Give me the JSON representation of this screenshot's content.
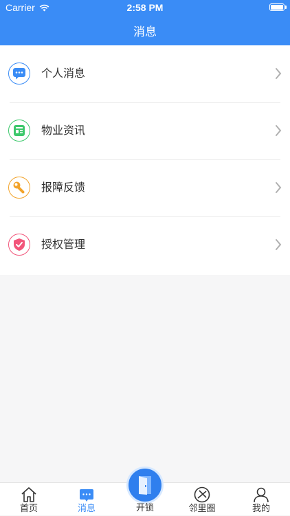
{
  "status_bar": {
    "carrier": "Carrier",
    "time": "2:58 PM",
    "wifi_icon": "wifi-icon",
    "battery_icon": "battery-icon"
  },
  "header": {
    "title": "消息"
  },
  "menu": {
    "items": [
      {
        "label": "个人消息",
        "icon": "chat-bubble-icon",
        "color": "#3a8cf6"
      },
      {
        "label": "物业资讯",
        "icon": "news-icon",
        "color": "#3cc86b"
      },
      {
        "label": "报障反馈",
        "icon": "wrench-icon",
        "color": "#f2a32a"
      },
      {
        "label": "授权管理",
        "icon": "shield-check-icon",
        "color": "#f2557a"
      }
    ]
  },
  "tab_bar": {
    "tabs": [
      {
        "label": "首页",
        "icon": "home-icon",
        "active": false
      },
      {
        "label": "消息",
        "icon": "message-icon",
        "active": true
      },
      {
        "label": "开锁",
        "icon": "door-icon",
        "active": false
      },
      {
        "label": "邻里圈",
        "icon": "compass-icon",
        "active": false
      },
      {
        "label": "我的",
        "icon": "user-icon",
        "active": false
      }
    ]
  },
  "colors": {
    "primary": "#3a8cf6",
    "background": "#f6f6f7"
  }
}
